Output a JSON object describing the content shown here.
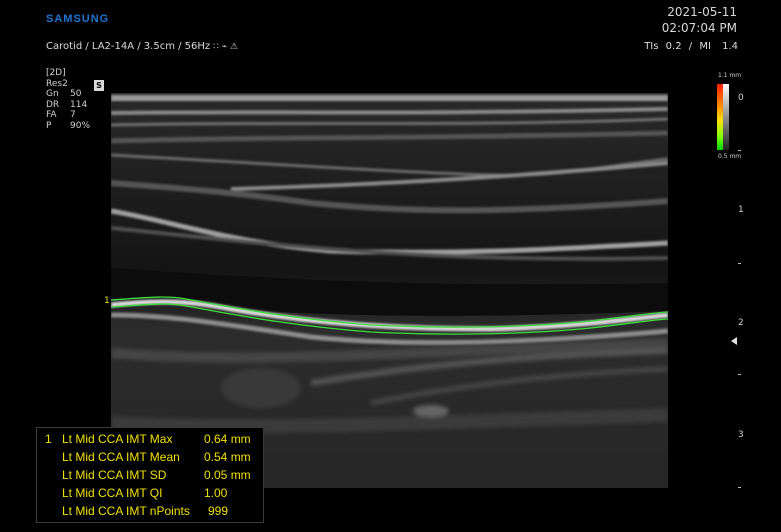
{
  "header": {
    "brand": "SAMSUNG",
    "probe_info": "Carotid / LA2-14A / 3.5cm / 56Hz",
    "date": "2021-05-11",
    "time": "02:07:04 PM",
    "tis_label": "TIs",
    "tis_value": "0.2",
    "mi_label": "MI",
    "mi_value": "1.4",
    "probe_icons": "∷ ⌁ ⚠"
  },
  "params": {
    "mode": "[2D]",
    "res": "Res2",
    "rows": [
      {
        "k": "Gn",
        "v": "50"
      },
      {
        "k": "DR",
        "v": "114"
      },
      {
        "k": "FA",
        "v": "7"
      },
      {
        "k": "P",
        "v": "90%"
      }
    ],
    "badge": "S"
  },
  "colorbar": {
    "top_label": "1.1 mm",
    "bottom_label": "0.5 mm",
    "zero": "0"
  },
  "depth_scale": {
    "marks": [
      "1",
      "2",
      "3"
    ]
  },
  "trace": {
    "label": "1",
    "color": "#3cdc3c"
  },
  "measurements": {
    "index": "1",
    "rows": [
      {
        "label": "Lt Mid CCA IMT Max",
        "value": "0.64 mm"
      },
      {
        "label": "Lt Mid CCA IMT Mean",
        "value": "0.54 mm"
      },
      {
        "label": "Lt Mid CCA IMT SD",
        "value": "0.05 mm"
      },
      {
        "label": "Lt Mid CCA IMT QI",
        "value": "1.00"
      },
      {
        "label": "Lt Mid CCA IMT nPoints",
        "value": "999"
      }
    ]
  }
}
